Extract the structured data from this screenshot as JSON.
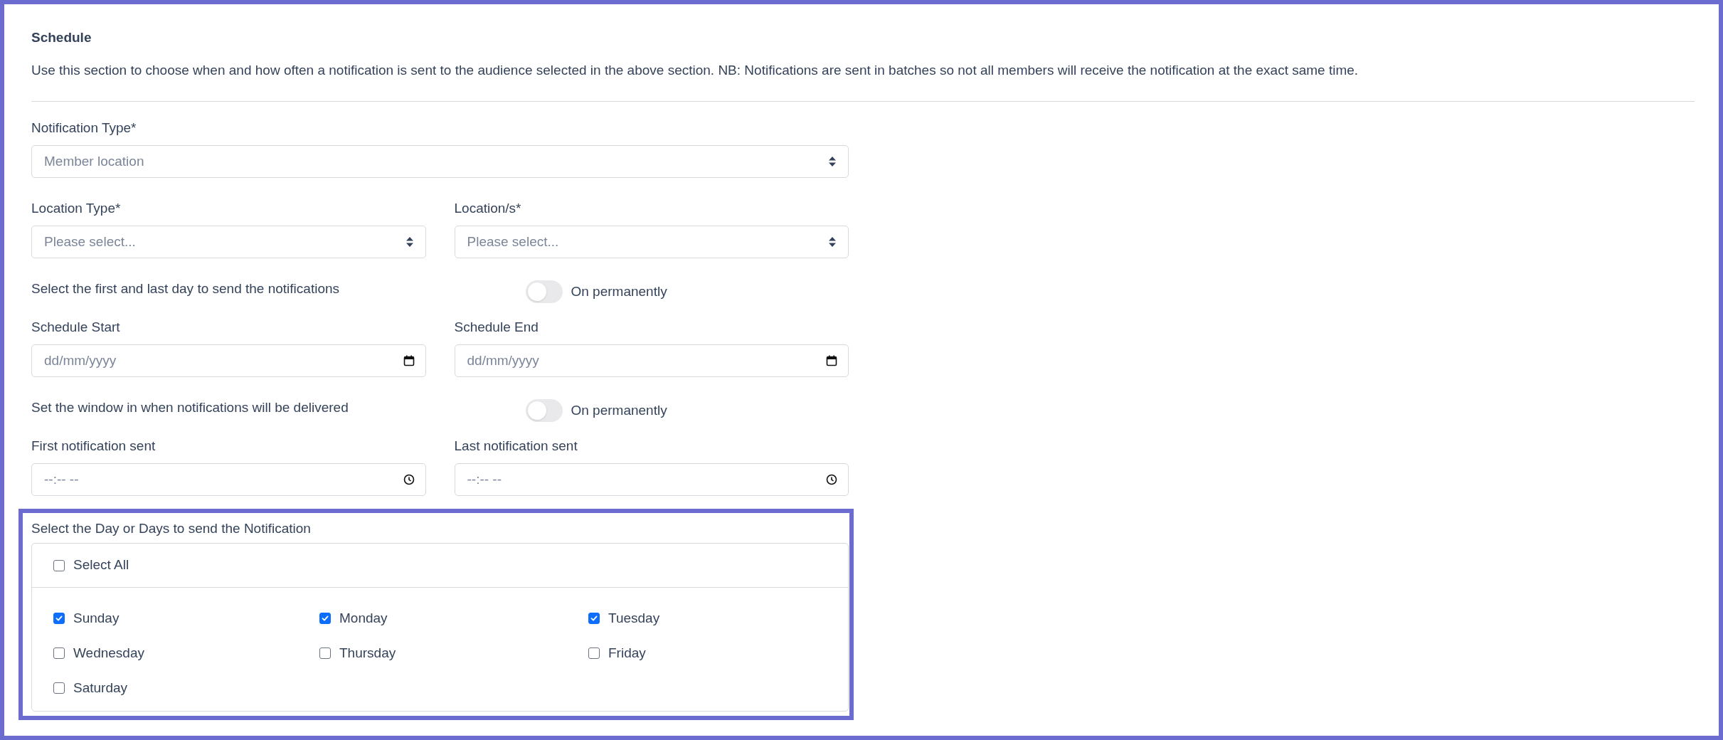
{
  "section": {
    "title": "Schedule",
    "description": "Use this section to choose when and how often a notification is sent to the audience selected in the above section. NB: Notifications are sent in batches so not all members will receive the notification at the exact same time."
  },
  "rows": [
    {
      "kind": "fields",
      "fields": [
        {
          "kind": "select",
          "label": "Notification Type*",
          "value": "Member location"
        }
      ]
    },
    {
      "kind": "fields",
      "fields": [
        {
          "kind": "select",
          "label": "Location Type*",
          "value": "Please select..."
        },
        {
          "kind": "select",
          "label": "Location/s*",
          "value": "Please select..."
        }
      ]
    },
    {
      "kind": "toggle",
      "text": "Select the first and last day to send the notifications",
      "toggle_label": "On permanently",
      "on": false
    },
    {
      "kind": "fields",
      "fields": [
        {
          "kind": "date",
          "label": "Schedule Start",
          "placeholder": "dd/mm/yyyy"
        },
        {
          "kind": "date",
          "label": "Schedule End",
          "placeholder": "dd/mm/yyyy"
        }
      ]
    },
    {
      "kind": "toggle",
      "text": "Set the window in when notifications will be delivered",
      "toggle_label": "On permanently",
      "on": false
    },
    {
      "kind": "fields",
      "fields": [
        {
          "kind": "time",
          "label": "First notification sent",
          "placeholder": "--:-- --"
        },
        {
          "kind": "time",
          "label": "Last notification sent",
          "placeholder": "--:-- --"
        }
      ]
    }
  ],
  "day_picker": {
    "label": "Select the Day or Days to send the Notification",
    "select_all": {
      "label": "Select All",
      "checked": false
    },
    "days": [
      {
        "label": "Sunday",
        "checked": true
      },
      {
        "label": "Monday",
        "checked": true
      },
      {
        "label": "Tuesday",
        "checked": true
      },
      {
        "label": "Wednesday",
        "checked": false
      },
      {
        "label": "Thursday",
        "checked": false
      },
      {
        "label": "Friday",
        "checked": false
      },
      {
        "label": "Saturday",
        "checked": false
      }
    ]
  }
}
